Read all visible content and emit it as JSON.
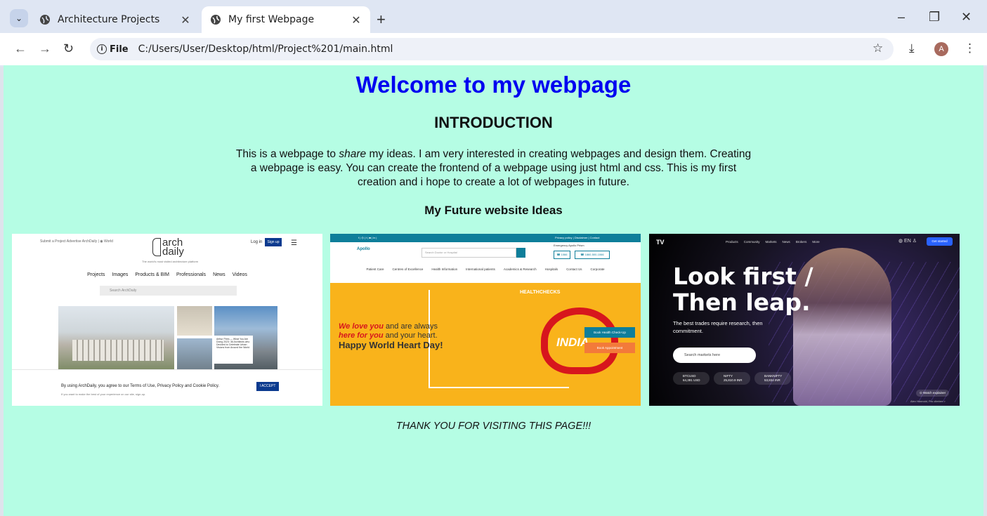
{
  "browser": {
    "tabs": [
      {
        "title": "Architecture Projects",
        "active": false
      },
      {
        "title": "My first Webpage",
        "active": true
      }
    ],
    "new_tab": "+",
    "window_controls": {
      "minimize": "–",
      "restore": "❐",
      "close": "✕"
    },
    "address": {
      "chip_label": "File",
      "url": "C:/Users/User/Desktop/html/Project%201/main.html"
    },
    "profile_initial": "A"
  },
  "page": {
    "background": "#b5fde4",
    "heading": "Welcome to my webpage",
    "intro_title": "INTRODUCTION",
    "intro_before": "This is a webpage to ",
    "intro_em": "share",
    "intro_after": " my ideas. I am very interested in creating webpages and design them. Creating a webpage is easy. You can create the frontend of a webpage using just html and css. This is my first creation and i hope to create a lot of webpages in future.",
    "ideas_title": "My Future website Ideas",
    "thanks": "THANK YOU FOR VISITING THIS PAGE!!!"
  },
  "archdaily": {
    "top_links": "Submit a Project   Advertise   ArchDaily   |   ◉ World",
    "logo_top": "arch",
    "logo_bottom": "daily",
    "login": "Log in",
    "signup": "Sign up",
    "tagline": "The world's most visited architecture platform",
    "nav": [
      "Projects",
      "Images",
      "Products & BIM",
      "Professionals",
      "News",
      "Videos"
    ],
    "search_placeholder": "Search ArchDaily",
    "card_text": "Arthur Pires — What You Are Doing 2023: 36 Architects who Decided to Celebrate Urban Visions from Around the World",
    "cookie_text": "By using ArchDaily, you agree to our Terms of Use, Privacy Policy and Cookie Policy.",
    "cookie_sub": "If you want to make the best of your experience on our site, sign-up.",
    "accept": "I ACCEPT"
  },
  "apollo": {
    "strip_left": "f | ◎ | t | ■ | in |",
    "strip_right": "Privacy policy  |  Disclaimer  |  Contact",
    "logo": "Apollo",
    "search_placeholder": "Search Doctor or Hospital",
    "emergency": "Emergency     Apollo Prism",
    "phone1": "☎ 1066",
    "phone2": "☎ 1860-500-1066",
    "menu": [
      "Patient Care",
      "Centres of Excellence",
      "Health Information",
      "International patients",
      "Academics & Research",
      "Hospitals",
      "Contact Us",
      "Corporate"
    ],
    "we_love": "We love you",
    "and_always": " and are always",
    "here_for": "here for you",
    "your_heart": " and your heart.",
    "heart_day": "Happy World Heart Day!",
    "healthchecks": "HEALTHCHECKS",
    "india": "INDIA",
    "btn_checkup": "Book Health Check-Up",
    "btn_appointment": "Book Appointment"
  },
  "tradingview": {
    "logo": "TV",
    "nav": [
      "Products",
      "Community",
      "Markets",
      "News",
      "Brokers",
      "More"
    ],
    "icons": "◍ EN  ♙",
    "get_started": "Get started",
    "headline_1": "Look first /",
    "headline_2": "Then leap.",
    "sub": "The best trades require research, then commitment.",
    "search_placeholder": "Search markets here",
    "tickers": [
      {
        "name": "BTCUSD",
        "value": "64,391 USD"
      },
      {
        "name": "NIFTY",
        "value": "25,810.9 INR"
      },
      {
        "name": "BANKNIFTY",
        "value": "53,834 INR"
      }
    ],
    "watch": "⊙ Watch explainer",
    "credit": "Alex Honnold, Pro climber >"
  }
}
